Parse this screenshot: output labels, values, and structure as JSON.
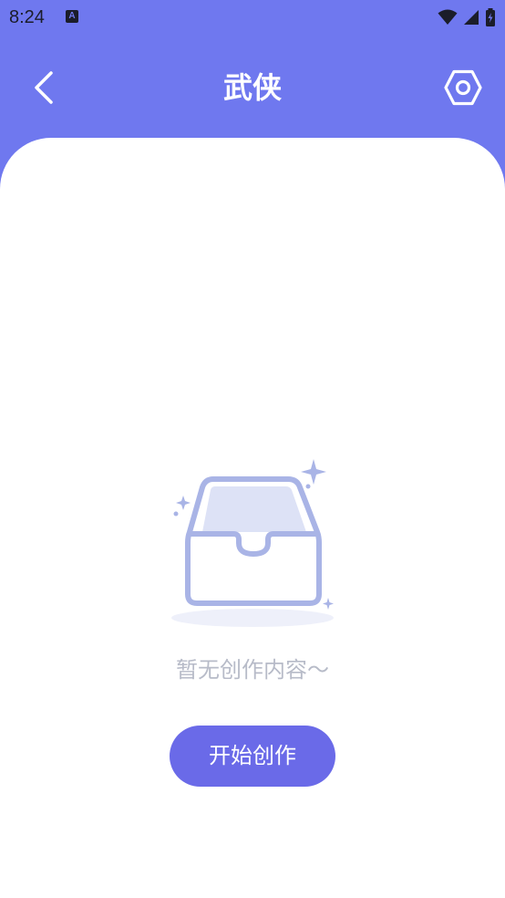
{
  "status_bar": {
    "time": "8:24",
    "notification_icon": "A"
  },
  "app_bar": {
    "title": "武侠",
    "back_icon": "chevron-left-icon",
    "settings_icon": "hexagon-settings-icon"
  },
  "empty_state": {
    "message": "暂无创作内容～",
    "button_label": "开始创作",
    "illustration": "empty-inbox-icon"
  },
  "colors": {
    "header_bg": "#6f78ef",
    "button_bg": "#6a6ae8",
    "illustration_stroke": "#a9b4e6",
    "illustration_fill": "#dde2f6",
    "empty_text": "#b7bbc8"
  }
}
